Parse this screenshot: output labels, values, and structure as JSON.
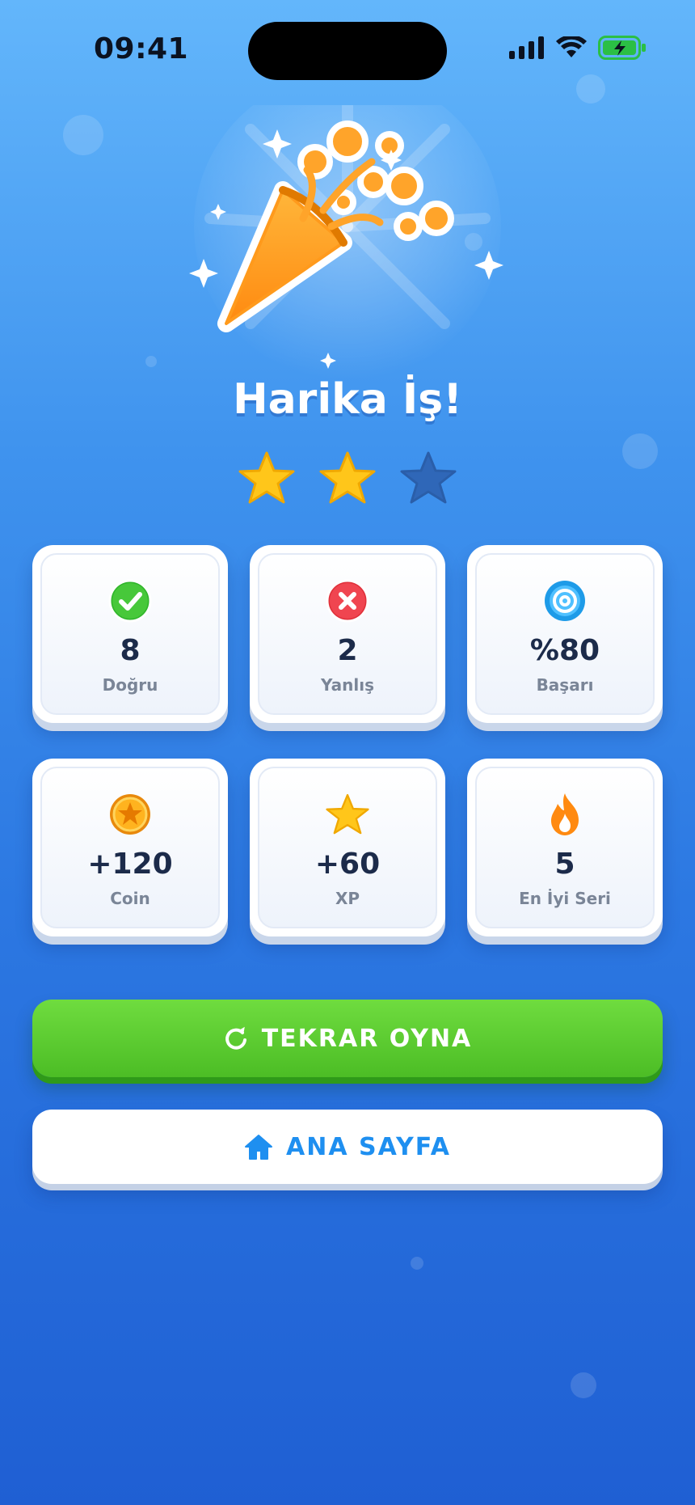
{
  "status_bar": {
    "time": "09:41"
  },
  "result": {
    "title": "Harika İş!",
    "stars_earned": 2,
    "stars_total": 3
  },
  "stats": [
    {
      "icon": "check-circle-icon",
      "value": "8",
      "label": "Doğru"
    },
    {
      "icon": "x-circle-icon",
      "value": "2",
      "label": "Yanlış"
    },
    {
      "icon": "target-icon",
      "value": "%80",
      "label": "Başarı"
    },
    {
      "icon": "coin-icon",
      "value": "+120",
      "label": "Coin"
    },
    {
      "icon": "star-icon",
      "value": "+60",
      "label": "XP"
    },
    {
      "icon": "flame-icon",
      "value": "5",
      "label": "En İyi Seri"
    }
  ],
  "buttons": {
    "play_again": "TEKRAR OYNA",
    "home": "ANA SAYFA"
  },
  "colors": {
    "accent_green": "#4cbd25",
    "accent_blue": "#1e8ff0",
    "star_gold": "#ffc61a",
    "star_empty": "#2f67b8"
  }
}
